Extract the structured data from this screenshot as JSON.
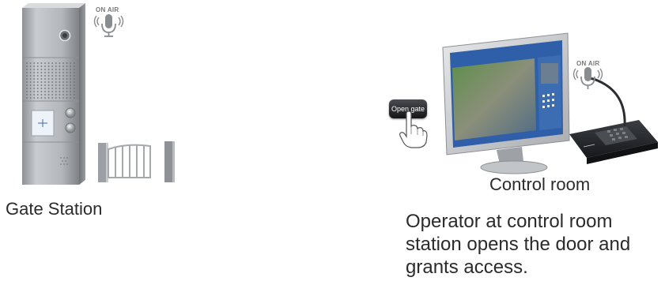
{
  "gate_station": {
    "on_air_label": "ON AIR",
    "caption": "Gate Station"
  },
  "control_room": {
    "on_air_label": "ON AIR",
    "open_gate_button": "Open gate",
    "caption": "Control room",
    "description": "Operator at control room station opens the door and grants access."
  },
  "icons": [
    "microphone-icon",
    "hand-pointer-icon",
    "brand-logo-icon"
  ],
  "colors": {
    "panel_gray": "#b9bcbf",
    "screen_blue": "#2f5fa8",
    "dark_desk": "#2a2c30"
  }
}
